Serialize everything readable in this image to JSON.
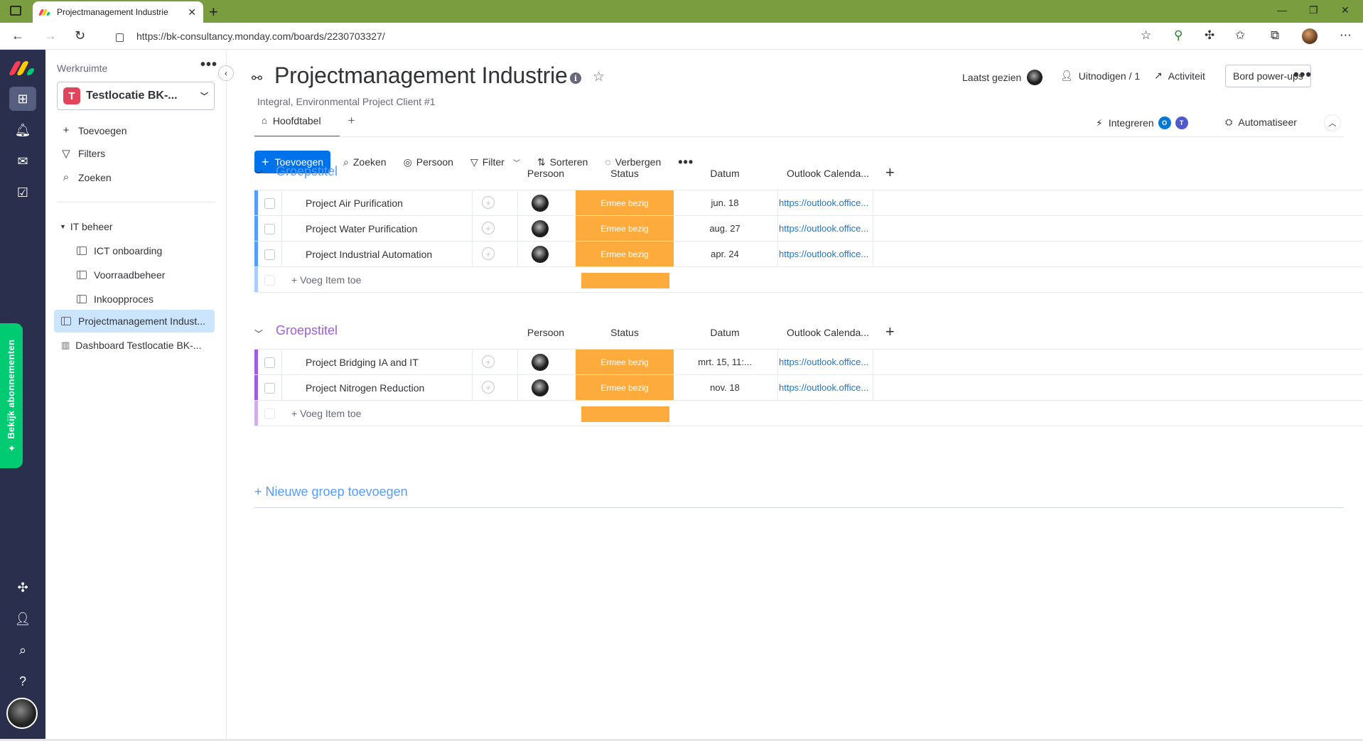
{
  "browser": {
    "tab_title": "Projectmanagement Industrie",
    "tab_close": "✕",
    "new_tab": "+",
    "url": "https://bk-consultancy.monday.com/boards/2230703327/"
  },
  "rail": {
    "subscriptions_label": "✦ Bekijk abonnementen"
  },
  "workspace": {
    "label": "Werkruimte",
    "more": "•••",
    "badge": "T",
    "name": "Testlocatie BK-...",
    "menu": [
      {
        "icon": "+",
        "label": "Toevoegen"
      },
      {
        "icon": "⚲",
        "label": "Filters"
      },
      {
        "icon": "⌕",
        "label": "Zoeken"
      }
    ],
    "folder": "IT beheer",
    "folder_boards": [
      "ICT onboarding",
      "Voorraadbeheer",
      "Inkoopproces"
    ],
    "boards": [
      "Projectmanagement Indust...",
      "Dashboard Testlocatie BK-..."
    ]
  },
  "board": {
    "title": "Projectmanagement Industrie",
    "info": "i",
    "subtitle": "Integral, Environmental Project Client #1",
    "last_seen": "Laatst gezien",
    "invite": "Uitnodigen / 1",
    "activity": "Activiteit",
    "powerups": "Bord power-ups",
    "more": "•••",
    "tab_main": "Hoofdtabel",
    "tab_add": "+",
    "integrate": "Integreren",
    "automate": "Automatiseer"
  },
  "toolbar": {
    "add": "Toevoegen",
    "search": "Zoeken",
    "person": "Persoon",
    "filter": "Filter",
    "sort": "Sorteren",
    "hide": "Verbergen",
    "more": "•••"
  },
  "columns": {
    "person": "Persoon",
    "status": "Status",
    "date": "Datum",
    "outlook": "Outlook Calenda...",
    "add": "+"
  },
  "groups": [
    {
      "title": "Groepstitel",
      "color": "#579bfc",
      "items": [
        {
          "name": "Project Air Purification",
          "status": "Ermee bezig",
          "date": "jun. 18",
          "link": "https://outlook.office..."
        },
        {
          "name": "Project Water Purification",
          "status": "Ermee bezig",
          "date": "aug. 27",
          "link": "https://outlook.office..."
        },
        {
          "name": "Project Industrial Automation",
          "status": "Ermee bezig",
          "date": "apr. 24",
          "link": "https://outlook.office..."
        }
      ],
      "add_item": "+ Voeg Item toe"
    },
    {
      "title": "Groepstitel",
      "color": "#a25ddc",
      "items": [
        {
          "name": "Project Bridging IA and IT",
          "status": "Ermee bezig",
          "date": "mrt. 15, 11:...",
          "link": "https://outlook.office..."
        },
        {
          "name": "Project Nitrogen Reduction",
          "status": "Ermee bezig",
          "date": "nov. 18",
          "link": "https://outlook.office..."
        }
      ],
      "add_item": "+ Voeg Item toe"
    }
  ],
  "new_group": "+ Nieuwe groep toevoegen",
  "colors": {
    "primary": "#0073ea",
    "status_working": "#fdab3d",
    "rail": "#292f4c",
    "subscriptions": "#00ca72"
  }
}
